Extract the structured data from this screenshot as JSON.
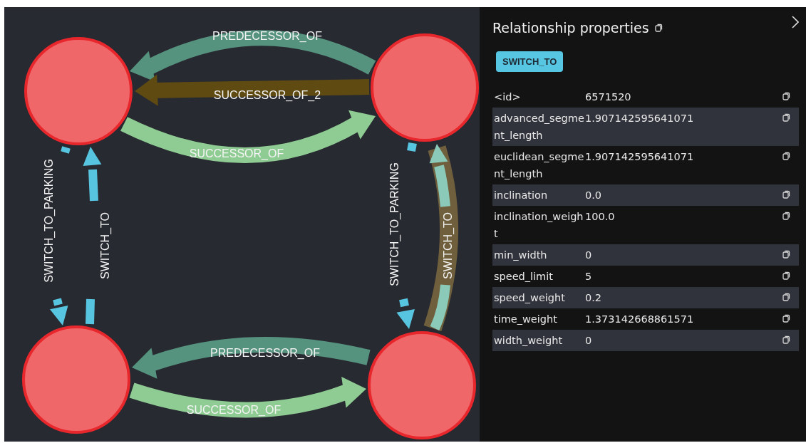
{
  "graph": {
    "edges": [
      {
        "label": "PREDECESSOR_OF",
        "color": "#56937f",
        "selected": false
      },
      {
        "label": "SUCCESSOR_OF_2",
        "color": "#5f4a12",
        "selected": false
      },
      {
        "label": "SUCCESSOR_OF",
        "color": "#8fcc93",
        "selected": false
      },
      {
        "label": "SWITCH_TO_PARKING",
        "color": "#57c5e0",
        "selected": false
      },
      {
        "label": "SWITCH_TO",
        "color": "#57c5e0",
        "selected": false
      },
      {
        "label": "SWITCH_TO_PARKING",
        "color": "#57c5e0",
        "selected": false
      },
      {
        "label": "SWITCH_TO",
        "color": "#8bc9b9",
        "selected": true
      },
      {
        "label": "PREDECESSOR_OF",
        "color": "#56937f",
        "selected": false
      },
      {
        "label": "SUCCESSOR_OF",
        "color": "#8fcc93",
        "selected": false
      }
    ]
  },
  "panel": {
    "title": "Relationship properties",
    "type_badge": "SWITCH_TO",
    "rows": [
      {
        "key": "<id>",
        "value": "6571520"
      },
      {
        "key": "advanced_segment_length",
        "value": "1.907142595641071"
      },
      {
        "key": "euclidean_segment_length",
        "value": "1.907142595641071"
      },
      {
        "key": "inclination",
        "value": "0.0"
      },
      {
        "key": "inclination_weight",
        "value": "100.0"
      },
      {
        "key": "min_width",
        "value": "0"
      },
      {
        "key": "speed_limit",
        "value": "5"
      },
      {
        "key": "speed_weight",
        "value": "0.2"
      },
      {
        "key": "time_weight",
        "value": "1.373142668861571"
      },
      {
        "key": "width_weight",
        "value": "0"
      }
    ]
  }
}
